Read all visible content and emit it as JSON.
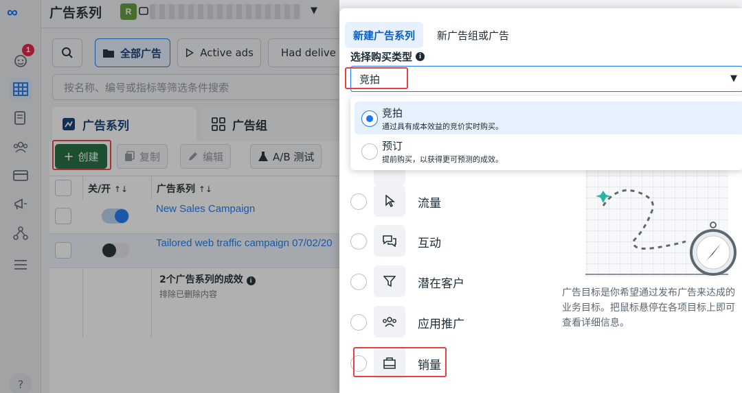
{
  "rail": {
    "notification_count": "1",
    "help_label": "?"
  },
  "header": {
    "title": "广告系列",
    "account_initial": "R"
  },
  "filters": {
    "all_ads": "全部广告",
    "active_ads": "Active ads",
    "had_delivery": "Had delive",
    "search_placeholder": "按名称、编号或指标等筛选条件搜索"
  },
  "tabs": {
    "campaigns": "广告系列",
    "adsets": "广告组"
  },
  "toolbar": {
    "create": "创建",
    "duplicate": "复制",
    "edit": "编辑",
    "ab_test": "A/B 测试"
  },
  "table": {
    "col_toggle": "关/开",
    "col_campaign": "广告系列",
    "rows": [
      {
        "name": "New Sales Campaign",
        "on": true
      },
      {
        "name": "Tailored web traffic campaign 07/02/20",
        "on": false
      }
    ],
    "summary_title": "2个广告系列的成效",
    "summary_sub": "排除已删除内容"
  },
  "modal": {
    "tab_new_campaign": "新建广告系列",
    "tab_new_adset": "新广告组或广告",
    "buying_type_label": "选择购买类型",
    "buying_type_value": "竞拍",
    "options": [
      {
        "title": "竞拍",
        "desc": "通过具有成本效益的竞价实时购买。",
        "selected": true
      },
      {
        "title": "预订",
        "desc": "提前购买，以获得更可预测的成效。",
        "selected": false
      }
    ],
    "objectives": [
      {
        "label": "流量"
      },
      {
        "label": "互动"
      },
      {
        "label": "潜在客户"
      },
      {
        "label": "应用推广"
      },
      {
        "label": "销量"
      }
    ],
    "objective_description": "广告目标是你希望通过发布广告来达成的业务目标。把鼠标悬停在各项目标上即可查看详细信息。"
  },
  "colors": {
    "accent": "#1877f2",
    "create_button": "#1b6b3a",
    "highlight": "#e83f3f"
  }
}
